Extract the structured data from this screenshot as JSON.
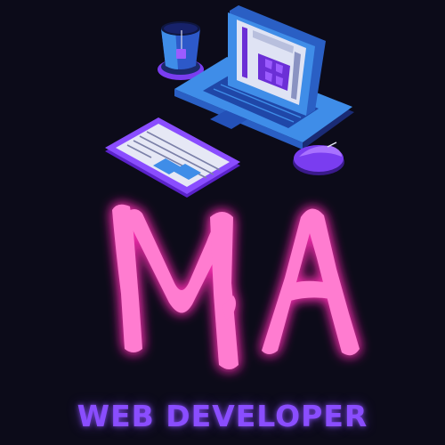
{
  "logo": {
    "monogram": "MA",
    "tagline": "WEB DEVELOPER",
    "monogram_icon": "ma-brush-letters",
    "illustration_icons": [
      "coffee-cup-icon",
      "laptop-icon",
      "tablet-icon",
      "mouse-icon"
    ]
  },
  "colors": {
    "background": "#0c0b19",
    "monogram": "#ff7bd0",
    "monogram_glow": "#ff2fb4",
    "tagline": "#8a4dff",
    "laptop_blue": "#3f8de8",
    "accent_purple": "#7a3df0"
  }
}
